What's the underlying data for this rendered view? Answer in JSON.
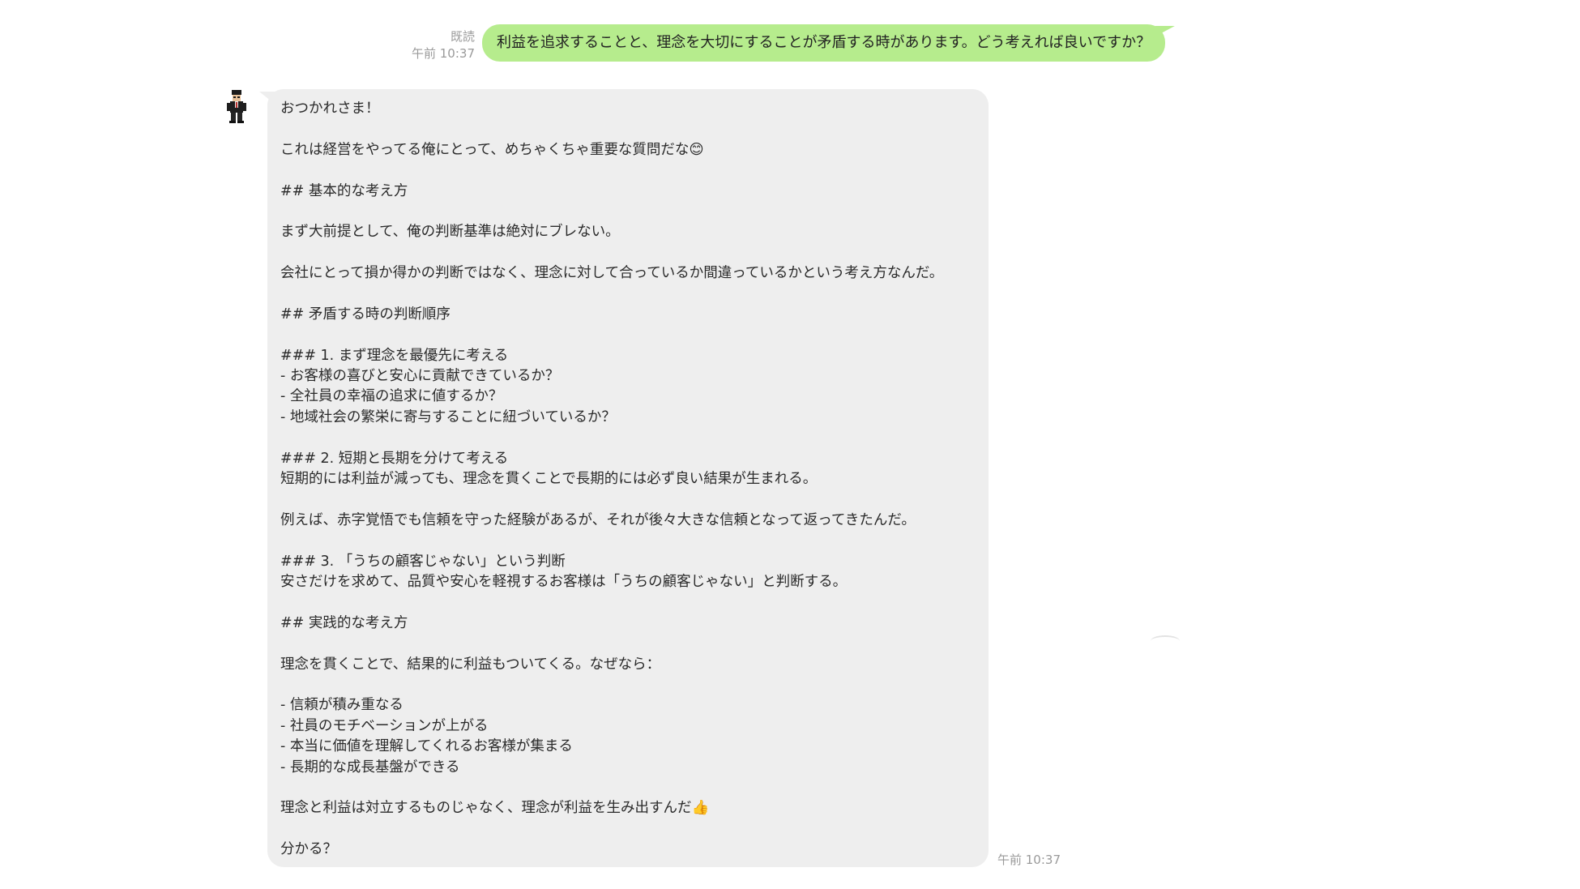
{
  "sent_message": {
    "read_label": "既読",
    "time": "午前 10:37",
    "text": "利益を追求することと、理念を大切にすることが矛盾する時があります。どう考えれば良いですか？"
  },
  "received_message": {
    "time": "午前 10:37",
    "lines": [
      "おつかれさま！",
      "",
      "これは経営をやってる俺にとって、めちゃくちゃ重要な質問だな😊",
      "",
      "## 基本的な考え方",
      "",
      "まず大前提として、俺の判断基準は絶対にブレない。",
      "",
      "会社にとって損か得かの判断ではなく、理念に対して合っているか間違っているかという考え方なんだ。",
      "",
      "## 矛盾する時の判断順序",
      "",
      "### 1. まず理念を最優先に考える",
      "- お客様の喜びと安心に貢献できているか？",
      "- 全社員の幸福の追求に値するか？",
      "- 地域社会の繁栄に寄与することに紐づいているか？",
      "",
      "### 2. 短期と長期を分けて考える",
      "短期的には利益が減っても、理念を貫くことで長期的には必ず良い結果が生まれる。",
      "",
      "例えば、赤字覚悟でも信頼を守った経験があるが、それが後々大きな信頼となって返ってきたんだ。",
      "",
      "### 3. 「うちの顧客じゃない」という判断",
      "安さだけを求めて、品質や安心を軽視するお客様は「うちの顧客じゃない」と判断する。",
      "",
      "## 実践的な考え方",
      "",
      "理念を貫くことで、結果的に利益もついてくる。なぜなら：",
      "",
      "- 信頼が積み重なる",
      "- 社員のモチベーションが上がる",
      "- 本当に価値を理解してくれるお客様が集まる",
      "- 長期的な成長基盤ができる",
      "",
      "理念と利益は対立するものじゃなく、理念が利益を生み出すんだ👍",
      "",
      "分かる？"
    ]
  },
  "colors": {
    "sent_bubble": "#b6ec8d",
    "received_bubble": "#eeeeee",
    "meta_text": "#9a9a9a"
  },
  "avatar_icon": "pixel-character-avatar-icon"
}
